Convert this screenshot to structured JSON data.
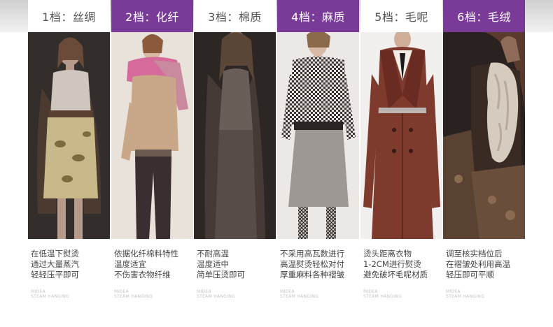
{
  "columns": [
    {
      "tab": "1档：丝绸",
      "tab_color": "#ffffff",
      "desc": [
        "在低温下熨烫",
        "通过大量蒸汽",
        "轻轻压平即可"
      ],
      "mark": [
        "MIDEA",
        "STEAM HANGING"
      ]
    },
    {
      "tab": "2档：化纤",
      "tab_color": "#7a3b98",
      "desc": [
        "依据化纤棉料特性",
        "温度适宜",
        "不伤害衣物纤维"
      ],
      "mark": [
        "MIDEA",
        "STEAM HANGING"
      ]
    },
    {
      "tab": "3档：棉质",
      "tab_color": "#ffffff",
      "desc": [
        "不耐高温",
        "温度适中",
        "简单压烫即可"
      ],
      "mark": [
        "MIDEA",
        "STEAM HANGING"
      ]
    },
    {
      "tab": "4档：麻质",
      "tab_color": "#7a3b98",
      "desc": [
        "不采用高瓦数进行",
        "高温熨烫轻松对付",
        "厚重麻料各种褶皱"
      ],
      "mark": [
        "MIDEA",
        "STEAM HANGING"
      ]
    },
    {
      "tab": "5档：毛呢",
      "tab_color": "#ffffff",
      "desc": [
        "烫头距离衣物",
        "1-2CM进行熨烫",
        "避免破坏毛呢材质"
      ],
      "mark": [
        "MIDEA",
        "STEAM HANGING"
      ]
    },
    {
      "tab": "6档：毛绒",
      "tab_color": "#7a3b98",
      "desc": [
        "调至核实档位后",
        "在褶皱处利用高温",
        "轻压即可平顺"
      ],
      "mark": [
        "MIDEA",
        "STEAM HANGING"
      ]
    }
  ]
}
